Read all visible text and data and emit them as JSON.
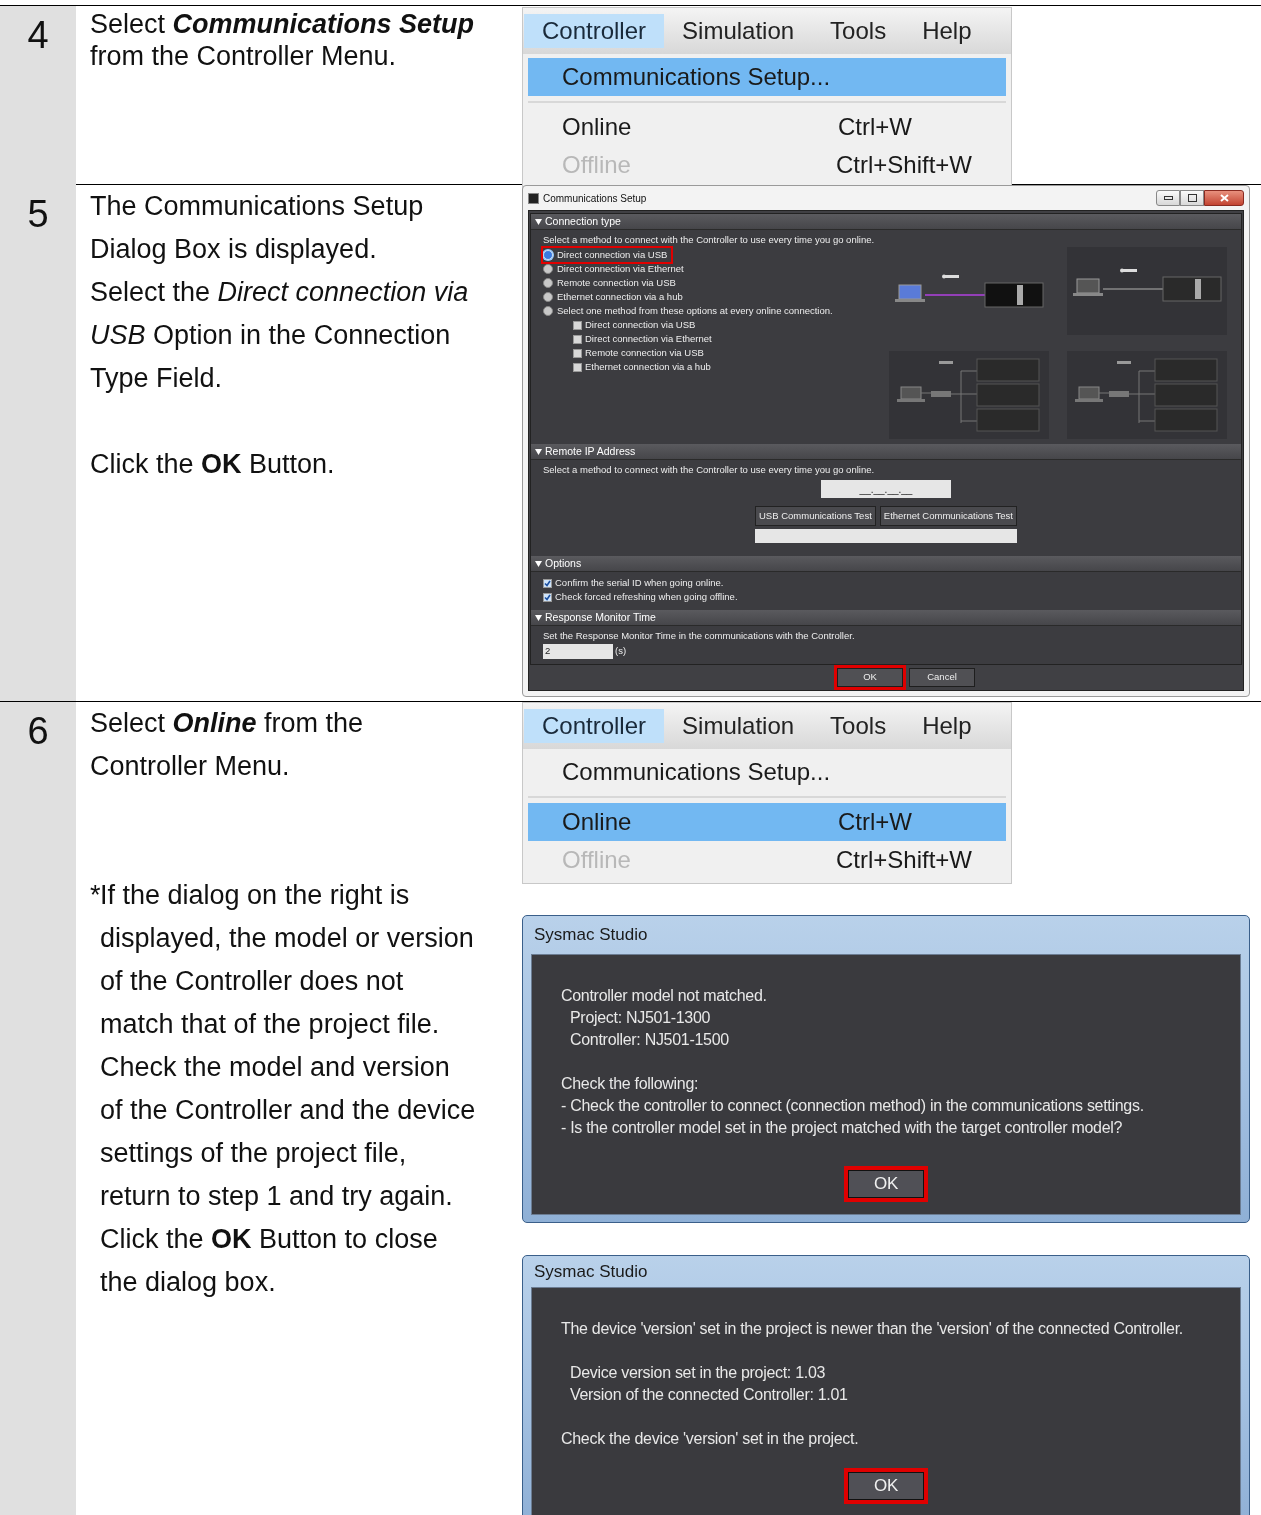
{
  "steps": [
    {
      "number": "4",
      "paragraphs": [
        [
          {
            "text": "Select ",
            "emphasis": false
          },
          {
            "text": "Communications Setup",
            "emphasis": true
          },
          {
            "text": " from the Controller Menu.",
            "emphasis": false
          }
        ]
      ],
      "panels": [
        {
          "kind": "menu",
          "menubar": [
            {
              "label": "Controller",
              "selected": true
            },
            {
              "label": "Simulation",
              "selected": false
            },
            {
              "label": "Tools",
              "selected": false
            },
            {
              "label": "Help",
              "selected": false
            }
          ],
          "items": [
            {
              "label": "Communications Setup...",
              "disabled": false,
              "selected": true
            },
            {
              "label": "Online",
              "shortcut": "Ctrl+W",
              "disabled": false,
              "selected": false
            },
            {
              "label": "Offline",
              "shortcut": "Ctrl+Shift+W",
              "disabled": true,
              "selected": false
            }
          ]
        }
      ]
    },
    {
      "number": "5",
      "paragraphs": [
        "The Communications Setup Dialog Box is displayed.",
        "Select the *Direct connection via USB* Option in the Connection Type Field.",
        "Click the **OK** Button."
      ],
      "panels": [
        {
          "kind": "comm_dialog",
          "title": "Communications Setup",
          "connection": {
            "header": "Connection type",
            "prompt": "Select a method to connect with the Controller to use every time you go online.",
            "radios": [
              {
                "label": "Direct connection via USB",
                "selected": true,
                "highlighted": true
              },
              {
                "label": "Direct connection via Ethernet",
                "selected": false,
                "highlighted": false
              },
              {
                "label": "Remote connection via USB",
                "selected": false,
                "highlighted": false
              },
              {
                "label": "Ethernet connection via a hub",
                "selected": false,
                "highlighted": false
              },
              {
                "label": "Select one method from these options at every online connection.",
                "selected": false,
                "highlighted": false
              }
            ],
            "checkboxes": [
              {
                "label": "Direct connection via USB",
                "checked": false
              },
              {
                "label": "Direct connection via Ethernet",
                "checked": false
              },
              {
                "label": "Remote connection via USB",
                "checked": false
              },
              {
                "label": "Ethernet connection via a hub",
                "checked": false
              }
            ]
          },
          "remote": {
            "header": "Remote IP Address",
            "prompt": "Select a method to connect with the Controller to use every time you go online.",
            "ip": "__.__.__.__",
            "buttons": [
              "USB Communications Test",
              "Ethernet Communications Test"
            ]
          },
          "options": {
            "header": "Options",
            "checkboxes": [
              {
                "label": "Confirm the serial ID when going online.",
                "checked": true
              },
              {
                "label": "Check forced refreshing when going offline.",
                "checked": true
              }
            ]
          },
          "response": {
            "header": "Response Monitor Time",
            "prompt": "Set the Response Monitor Time in the communications with the Controller.",
            "value": "2",
            "unit": "(s)"
          },
          "buttons": [
            {
              "label": "OK",
              "highlighted": true
            },
            {
              "label": "Cancel",
              "highlighted": false
            }
          ]
        }
      ]
    },
    {
      "number": "6",
      "paragraphs": [
        [
          {
            "text": "Select ",
            "emphasis": false
          },
          {
            "text": "Online",
            "emphasis": true
          },
          {
            "text": " from the Controller Menu.",
            "emphasis": false
          }
        ]
      ],
      "note": {
        "mark": "*",
        "text": "If the dialog on the right is displayed, the model or version of the Controller does not match that of the project file. Check the model and version of the Controller and the device settings of the project file, return to step 1 and try again. Click the **OK** Button to close the dialog box."
      },
      "panels": [
        {
          "kind": "menu",
          "menubar": [
            {
              "label": "Controller",
              "selected": true
            },
            {
              "label": "Simulation",
              "selected": false
            },
            {
              "label": "Tools",
              "selected": false
            },
            {
              "label": "Help",
              "selected": false
            }
          ],
          "items": [
            {
              "label": "Communications Setup...",
              "disabled": false,
              "selected": false
            },
            {
              "label": "Online",
              "shortcut": "Ctrl+W",
              "disabled": false,
              "selected": true
            },
            {
              "label": "Offline",
              "shortcut": "Ctrl+Shift+W",
              "disabled": true,
              "selected": false
            }
          ]
        },
        {
          "kind": "message_dialog",
          "title": "Sysmac Studio",
          "groups": [
            [
              {
                "text": "Controller model not matched.",
                "indented": false
              },
              {
                "text": "Project: NJ501-1300",
                "indented": true
              },
              {
                "text": "Controller: NJ501-1500",
                "indented": true
              }
            ],
            [
              {
                "text": "Check the following:",
                "indented": false
              },
              {
                "text": "- Check the controller to connect (connection method) in the communications settings.",
                "indented": false
              },
              {
                "text": "- Is the controller model set in the project matched with the target controller model?",
                "indented": false
              }
            ]
          ],
          "button": {
            "label": "OK",
            "highlighted": true
          }
        },
        {
          "kind": "message_dialog",
          "title": "Sysmac Studio",
          "groups": [
            [
              {
                "text": "The device 'version' set in the project is newer than the 'version' of the connected Controller.",
                "indented": false
              }
            ],
            [
              {
                "text": "Device version set in the project: 1.03",
                "indented": true
              },
              {
                "text": "Version of the connected Controller: 1.01",
                "indented": true
              }
            ],
            [
              {
                "text": "Check the device 'version' set in the project.",
                "indented": false
              }
            ]
          ],
          "button": {
            "label": "OK",
            "highlighted": true
          }
        }
      ]
    }
  ]
}
